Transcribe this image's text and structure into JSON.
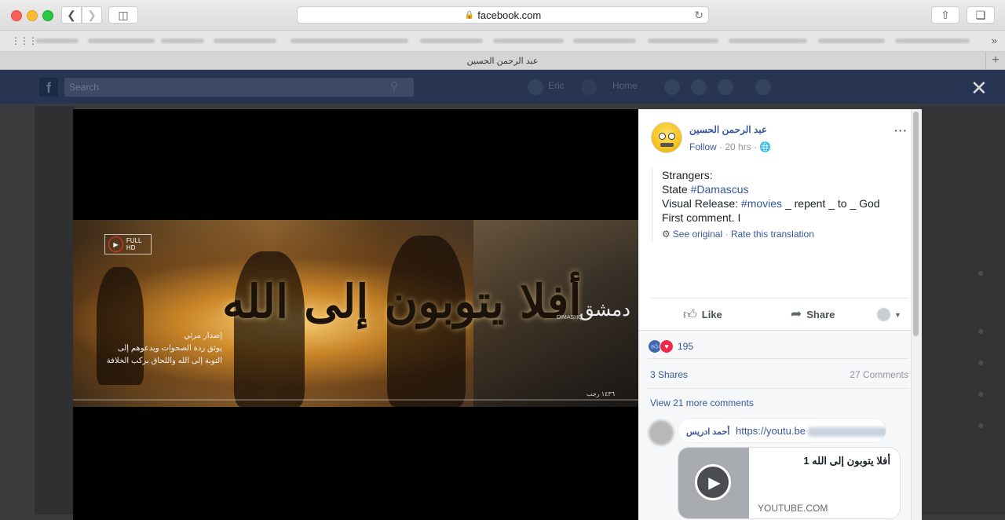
{
  "browser": {
    "url": "facebook.com",
    "tab_title": "عبد الرحمن الحسين",
    "new_tab_label": "+"
  },
  "fb_header": {
    "search_placeholder": "Search",
    "user_name": "Eric",
    "home_label": "Home"
  },
  "video": {
    "thumbnail_title": "أفلا يتوبون إلى الله",
    "logo_text": "دمشق",
    "logo_small": "DIMASHQ",
    "caption_lines": [
      "إصدار مرئي",
      "يوثق ردة الصحوات ويدعوهم إلى",
      "التوبة إلى الله واللحاق بركب الخلافة"
    ],
    "badge_text": "FULL HD",
    "date_text": "١٤٣٦ رجب"
  },
  "post": {
    "author": "عبد الرحمن الحسين",
    "follow_label": "Follow",
    "time": "20 hrs",
    "text_line1": "Strangers:",
    "text_line2_prefix": "State ",
    "text_line2_tag": "#Damascus",
    "text_line3_prefix": "Visual Release: ",
    "text_line3_tag": "#movies",
    "text_line3_suffix": " _ repent _ to _ God",
    "text_line4": "First comment. I",
    "see_original": "See original",
    "rate_translation": "Rate this translation",
    "like_label": "Like",
    "share_label": "Share",
    "reaction_count": "195",
    "shares_label": "3 Shares",
    "comments_label": "27 Comments",
    "view_more_label": "View 21 more comments"
  },
  "comment": {
    "author": "أحمد ادريس",
    "link_text": "https://youtu.be"
  },
  "link_card": {
    "title": "أفلا يتوبون إلى الله 1",
    "domain": "YOUTUBE.COM"
  },
  "colors": {
    "fb_link": "#365899",
    "like_blue": "#4267b2",
    "love_red": "#f0284a"
  }
}
